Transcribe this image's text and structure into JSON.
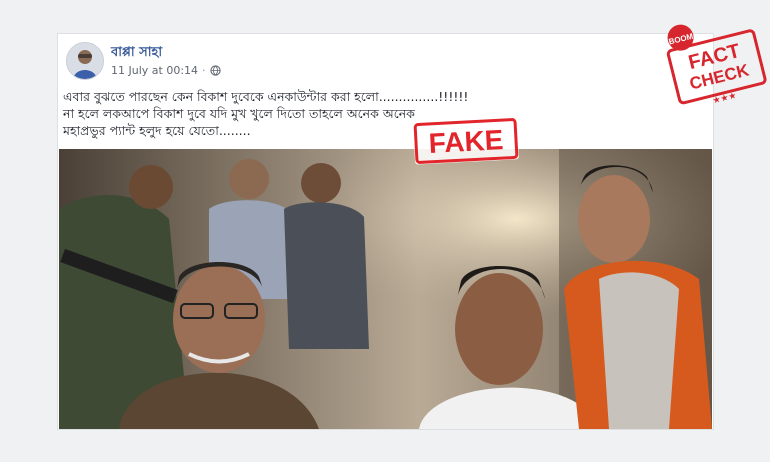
{
  "post": {
    "author": "বাপ্পা সাহা",
    "timestamp": "11 July at 00:14",
    "separator": "·",
    "audience_icon": "globe-icon",
    "text_lines": [
      "এবার বুঝতে পারছেন কেন বিকাশ দুবেকে এনকাউন্টার করা হলো...............!!!!!!",
      "না হলে লকআপে বিকাশ দুবে যদি মুখ খুলে দিতো তাহলে অনেক অনেক",
      "মহাপ্রভুর প্যান্ট হলুদ হয়ে যেতো........"
    ]
  },
  "fake_label": "FAKE",
  "fact_check": {
    "brand": "BOOM",
    "line1": "FACT",
    "line2": "CHECK",
    "stars": "★★★"
  },
  "colors": {
    "link_blue": "#385898",
    "stamp_red": "#d7262d",
    "fake_red": "#e2252b"
  }
}
